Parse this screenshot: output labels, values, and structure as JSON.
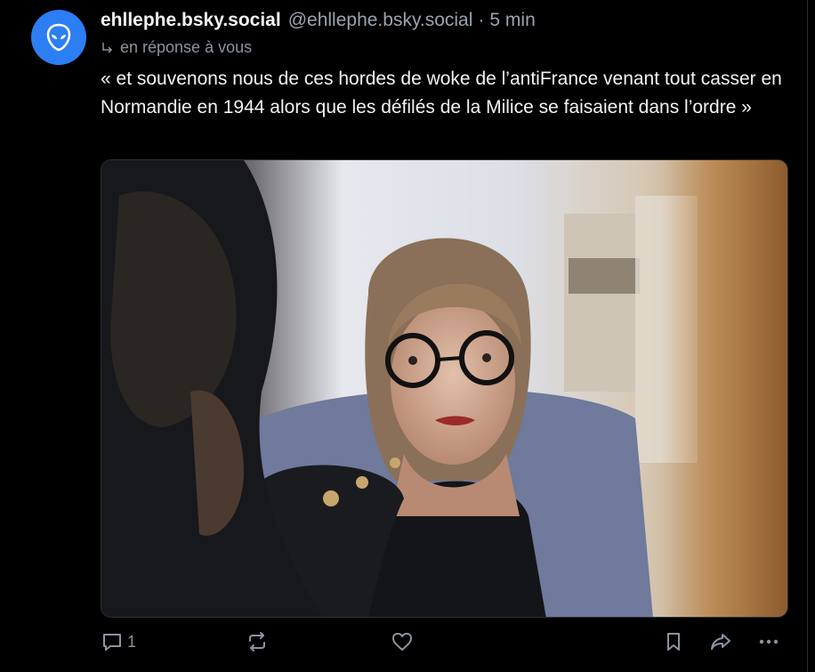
{
  "post": {
    "display_name": "ehllephe.bsky.social",
    "handle": "@ehllephe.bsky.social",
    "separator": "·",
    "timestamp": "5 min",
    "reply_to_label": "en réponse à vous",
    "text": "«  et souvenons nous de ces hordes de woke de l’antiFrance venant tout casser en Normandie en 1944 alors que les défilés de la Milice se faisaient dans l’ordre »",
    "avatar_icon": "alien-icon",
    "avatar_color": "#2c7ef4"
  },
  "actions": {
    "reply_count": "1",
    "reply_icon": "comment-icon",
    "repost_icon": "repost-icon",
    "like_icon": "heart-icon",
    "bookmark_icon": "bookmark-icon",
    "share_icon": "share-icon",
    "more_icon": "more-icon"
  },
  "colors": {
    "background": "#000000",
    "text_primary": "#f1f3f5",
    "text_secondary": "#8b94a0"
  }
}
